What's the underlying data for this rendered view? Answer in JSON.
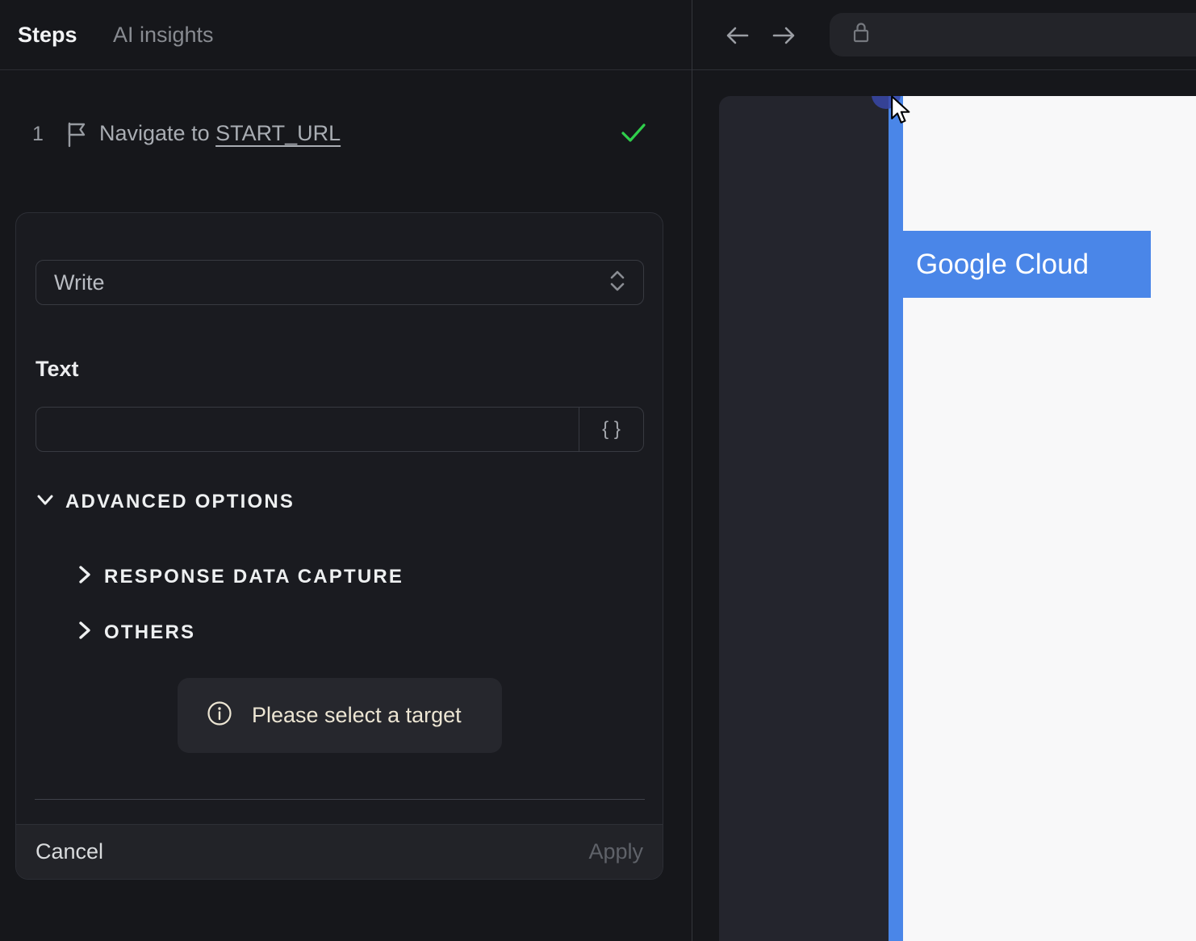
{
  "left_panel": {
    "tabs": [
      {
        "label": "Steps",
        "active": true
      },
      {
        "label": "AI insights",
        "active": false
      }
    ],
    "step": {
      "number": "1",
      "title_prefix": "Navigate to ",
      "title_link": "START_URL",
      "status": "success"
    },
    "editor": {
      "action_select": {
        "value": "Write"
      },
      "text_label": "Text",
      "text_input": {
        "value": "",
        "placeholder": ""
      },
      "variable_button_label": "{ }",
      "advanced_options_label": "ADVANCED OPTIONS",
      "sections": [
        {
          "label": "RESPONSE DATA CAPTURE",
          "expanded": false
        },
        {
          "label": "OTHERS",
          "expanded": false
        }
      ],
      "notice": "Please select a target",
      "cancel_label": "Cancel",
      "apply_label": "Apply"
    }
  },
  "browser": {
    "toolbar": {
      "icons": [
        "back-arrow",
        "forward-arrow",
        "lock"
      ]
    },
    "preview": {
      "highlight_text": "Google Cloud"
    }
  },
  "colors": {
    "accent_blue": "#4a86e8",
    "success_green": "#2fcf4b",
    "notice_text": "#ece5d3",
    "panel_bg": "#16171b",
    "site_dark": "#24252d",
    "site_white": "#f8f8f9",
    "selection_dot": "#3848a8"
  }
}
